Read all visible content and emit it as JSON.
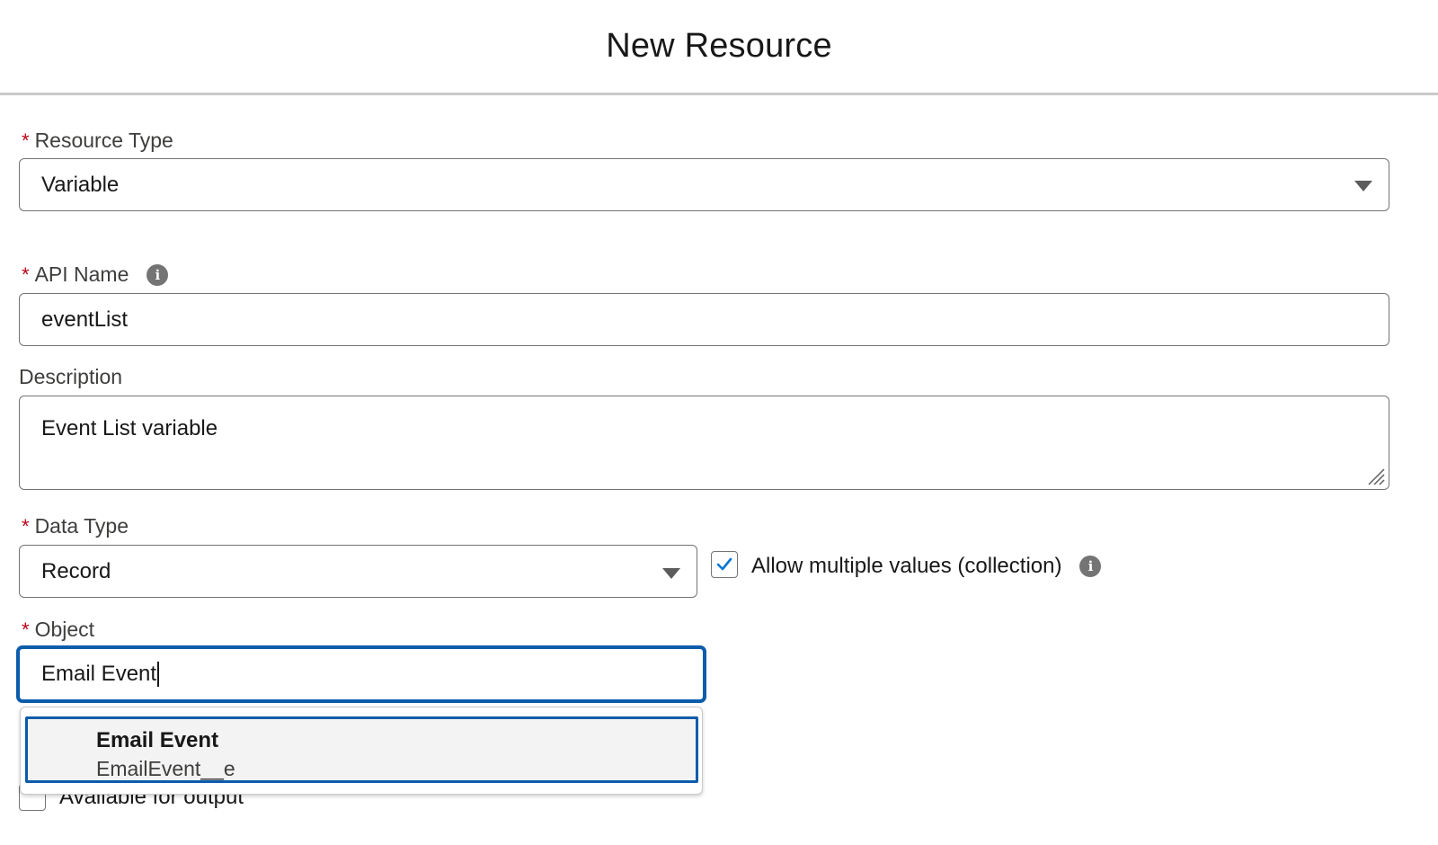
{
  "modal": {
    "title": "New Resource"
  },
  "form": {
    "required_marker": "*",
    "resource_type": {
      "label": "Resource Type",
      "value": "Variable"
    },
    "api_name": {
      "label": "API Name",
      "value": "eventList",
      "info_icon": "info-icon"
    },
    "description": {
      "label": "Description",
      "value": "Event List variable"
    },
    "data_type": {
      "label": "Data Type",
      "value": "Record"
    },
    "allow_multiple": {
      "label": "Allow multiple values (collection)",
      "checked": true,
      "info_icon": "info-icon"
    },
    "object": {
      "label": "Object",
      "value": "Email Event",
      "options": [
        {
          "title": "Email Event",
          "api": "EmailEvent__e"
        }
      ]
    },
    "available_for_output": {
      "label": "Available for output",
      "checked": false
    }
  },
  "colors": {
    "required": "#ba0517",
    "focus_border": "#0b5cab",
    "checkmark": "#0176d3"
  }
}
